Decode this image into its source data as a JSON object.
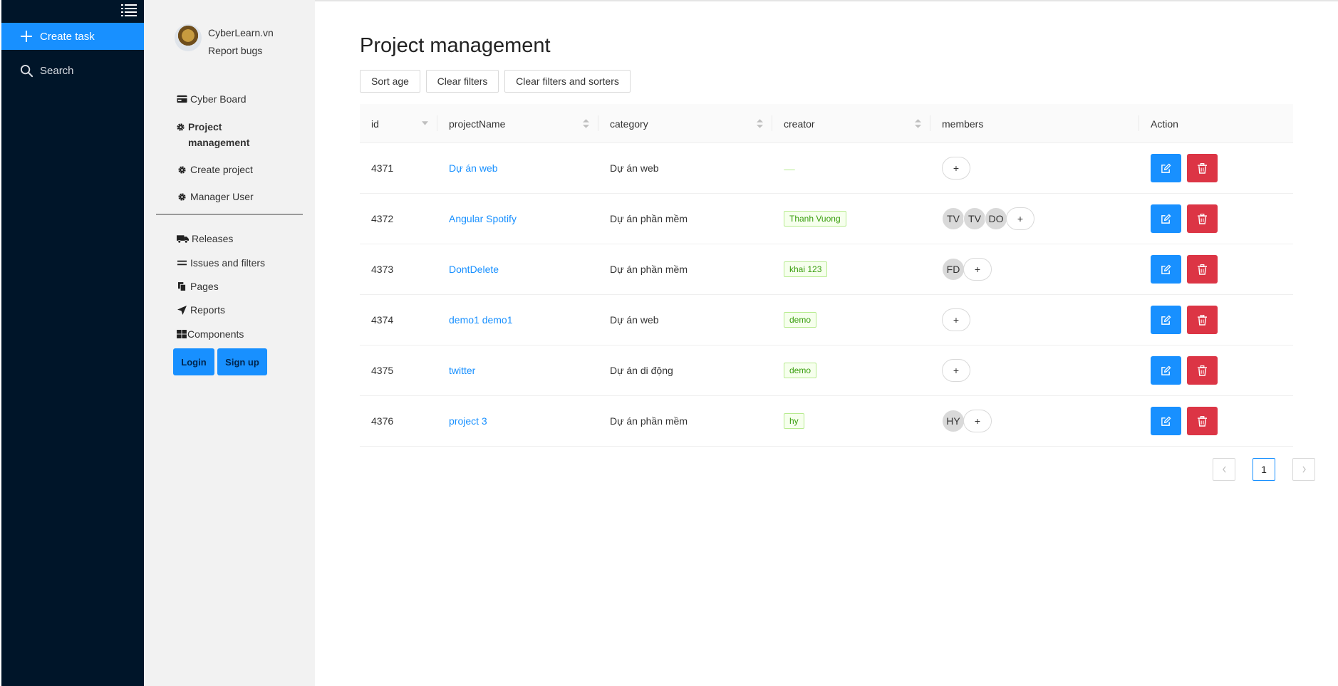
{
  "sidebar_dark": {
    "menu_toggle_icon": "list-icon",
    "create_task": {
      "label": "Create task",
      "icon": "plus-icon"
    },
    "search": {
      "label": "Search",
      "icon": "search-icon"
    },
    "colors": {
      "background": "#001529",
      "active": "#1890ff"
    }
  },
  "menu": {
    "brand_name": "CyberLearn.vn",
    "report_bugs": "Report bugs",
    "items": [
      {
        "label": "Cyber Board",
        "icon": "credit-card-icon"
      },
      {
        "label": "Project management",
        "icon": "gear-icon",
        "active": true
      },
      {
        "label": "Create project",
        "icon": "gear-icon"
      },
      {
        "label": "Manager User",
        "icon": "gear-icon"
      }
    ],
    "secondary_items": [
      {
        "label": "Releases",
        "icon": "truck-icon"
      },
      {
        "label": "Issues and filters",
        "icon": "equals-icon"
      },
      {
        "label": "Pages",
        "icon": "copy-icon"
      },
      {
        "label": "Reports",
        "icon": "location-arrow-icon"
      },
      {
        "label": "Components",
        "icon": "boxes-icon"
      }
    ],
    "login": "Login",
    "signup": "Sign up"
  },
  "page": {
    "title": "Project management",
    "buttons": {
      "sort_age": "Sort age",
      "clear_filters": "Clear filters",
      "clear_all": "Clear filters and sorters"
    }
  },
  "table": {
    "columns": [
      "id",
      "projectName",
      "category",
      "creator",
      "members",
      "Action"
    ],
    "rows": [
      {
        "id": "4371",
        "projectName": "Dự án web",
        "category": "Dự án web",
        "creator": "",
        "members": []
      },
      {
        "id": "4372",
        "projectName": "Angular Spotify",
        "category": "Dự án phần mềm",
        "creator": "Thanh Vuong",
        "members": [
          "TV",
          "TV",
          "DO"
        ]
      },
      {
        "id": "4373",
        "projectName": "DontDelete",
        "category": "Dự án phần mềm",
        "creator": "khai 123",
        "members": [
          "FD"
        ]
      },
      {
        "id": "4374",
        "projectName": "demo1 demo1",
        "category": "Dự án web",
        "creator": "demo",
        "members": []
      },
      {
        "id": "4375",
        "projectName": "twitter",
        "category": "Dự án di động",
        "creator": "demo",
        "members": []
      },
      {
        "id": "4376",
        "projectName": "project 3",
        "category": "Dự án phần mềm",
        "creator": "hy",
        "members": [
          "HY"
        ]
      }
    ],
    "add_member_label": "+",
    "edit_icon": "edit-icon",
    "delete_icon": "trash-icon",
    "colors": {
      "edit": "#1890ff",
      "delete": "#dc3545",
      "link": "#1890ff",
      "tag": "#389e0d"
    }
  },
  "pagination": {
    "prev": "<",
    "current": "1",
    "next": ">"
  }
}
